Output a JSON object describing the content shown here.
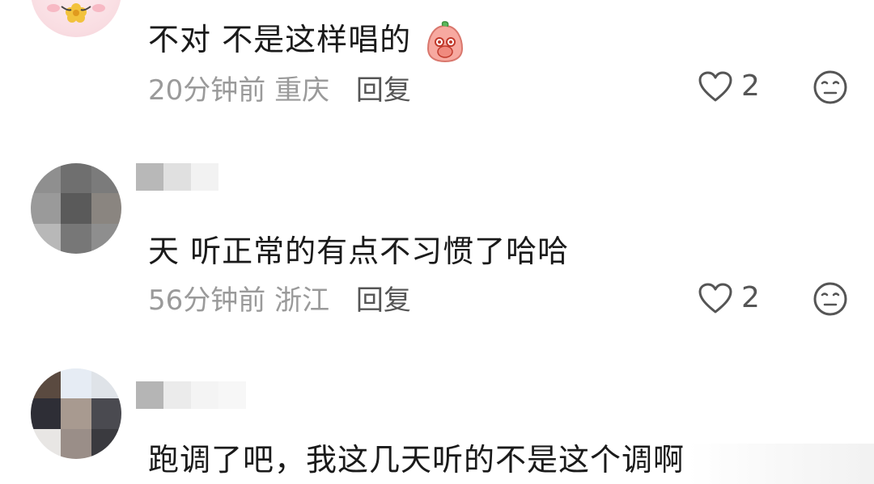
{
  "comments": [
    {
      "text": "不对 不是这样唱的",
      "emoji": "blushing-face-emoji",
      "time": "20分钟前",
      "location": "重庆",
      "reply_label": "回复",
      "likes": "2"
    },
    {
      "text": "天 听正常的有点不习惯了哈哈",
      "time": "56分钟前",
      "location": "浙江",
      "reply_label": "回复",
      "likes": "2"
    },
    {
      "text": "跑调了吧，我这几天听的不是这个调啊"
    }
  ],
  "colors": {
    "text": "#1a1a1a",
    "meta": "#9a9a9a",
    "reply": "#555555",
    "icon": "#555555"
  }
}
